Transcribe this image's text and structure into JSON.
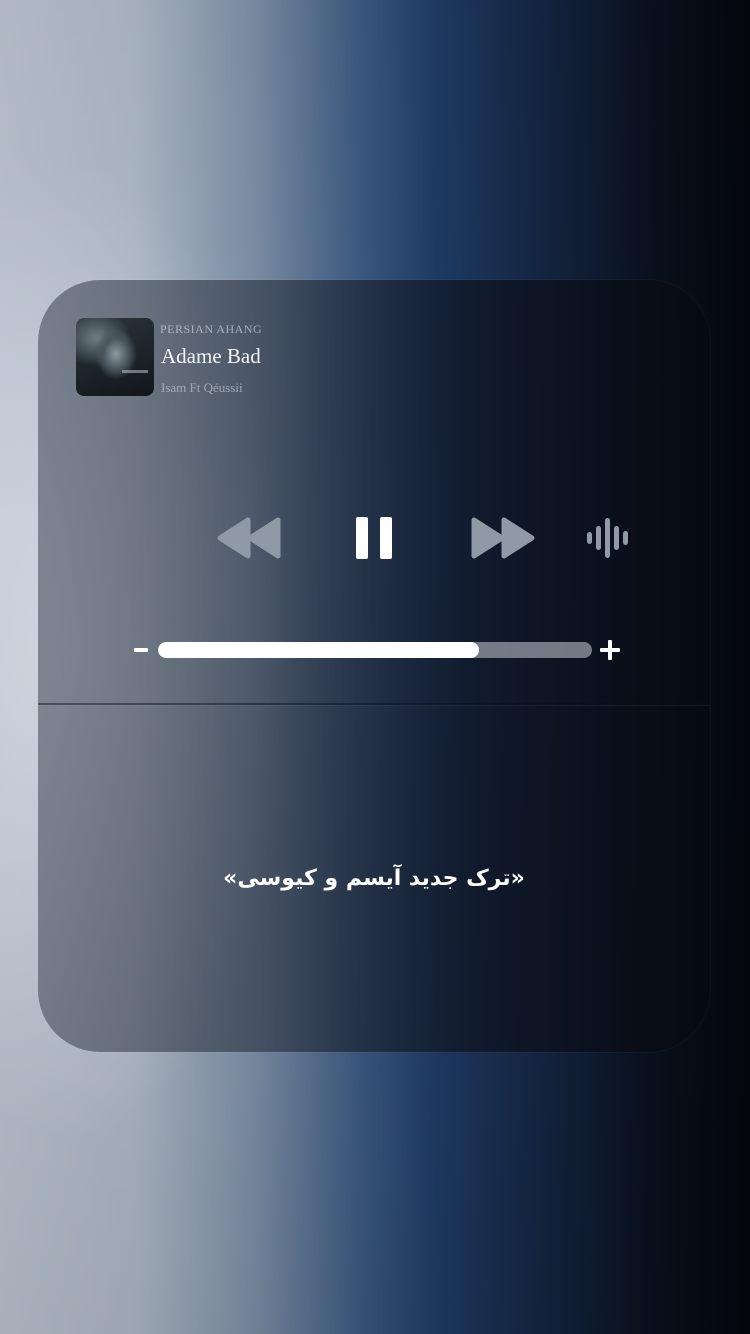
{
  "player": {
    "source": "PERSIAN AHANG",
    "title": "Adame Bad",
    "artist": "Isam Ft Qéussii",
    "album_art_icon": "album-art",
    "controls": {
      "rewind_icon": "rewind-icon",
      "pause_icon": "pause-icon",
      "forward_icon": "fast-forward-icon",
      "audio_icon": "audio-waveform-icon"
    },
    "volume": {
      "minus_icon": "volume-minus-icon",
      "plus_icon": "volume-plus-icon",
      "level_fraction": 0.74
    }
  },
  "caption": "«ترک جدید آیسم و کیوسی»",
  "colors": {
    "control_dim": "#8f9aa6",
    "control_active": "#ffffff",
    "slider_fill": "#ffffff",
    "slider_track": "#969ca6"
  }
}
